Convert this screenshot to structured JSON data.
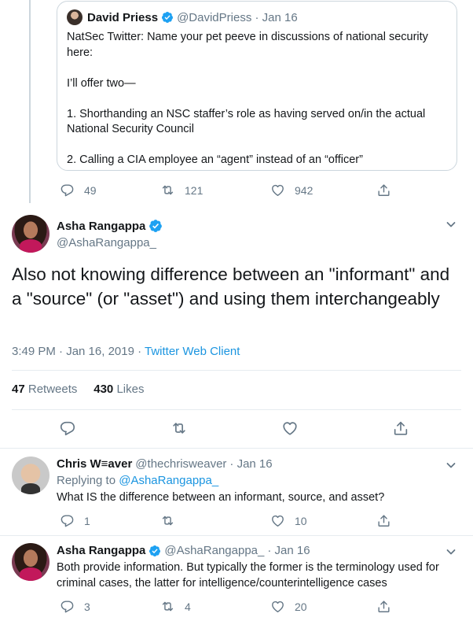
{
  "quoted_tweet": {
    "author_name": "David Priess",
    "author_handle": "@DavidPriess",
    "date": "Jan 16",
    "text_lines": [
      "NatSec Twitter: Name your pet peeve in discussions of national security here:",
      "",
      "I’ll offer two—",
      "",
      "1. Shorthanding an NSC staffer’s role as having served on/in the actual National Security Council",
      "",
      "2. Calling a CIA employee an “agent” instead of an “officer”"
    ],
    "replies": "49",
    "retweets": "121",
    "likes": "942"
  },
  "main_tweet": {
    "author_name": "Asha Rangappa",
    "author_handle": "@AshaRangappa_",
    "text": "Also not knowing difference between an \"informant\" and a \"source\" (or \"asset\") and using them interchangeably",
    "timestamp": "3:49 PM · Jan 16, 2019 · ",
    "client": "Twitter Web Client",
    "retweets_count": "47",
    "retweets_label": "Retweets",
    "likes_count": "430",
    "likes_label": "Likes"
  },
  "replies": [
    {
      "author_name": "Chris W≡aver",
      "author_handle": "@thechrisweaver",
      "date": "· Jan 16",
      "replying_to_label": "Replying to ",
      "replying_to_handle": "@AshaRangappa_",
      "text": "What IS the difference between an informant, source, and asset?",
      "reply_count": "1",
      "retweet_count": "",
      "like_count": "10"
    },
    {
      "author_name": "Asha Rangappa",
      "author_handle": "@AshaRangappa_",
      "date": "· Jan 16",
      "text": "Both provide information. But typically the former is the terminology used for criminal cases, the latter for intelligence/counterintelligence cases",
      "reply_count": "3",
      "retweet_count": "4",
      "like_count": "20"
    }
  ],
  "icons": {
    "verified": "verified-badge-icon",
    "reply": "reply-icon",
    "retweet": "retweet-icon",
    "like": "heart-icon",
    "share": "share-icon",
    "more": "chevron-down-icon"
  },
  "colors": {
    "accent": "#1b95e0",
    "verified": "#1da1f2",
    "muted": "#657786",
    "border": "#e6ecf0"
  }
}
